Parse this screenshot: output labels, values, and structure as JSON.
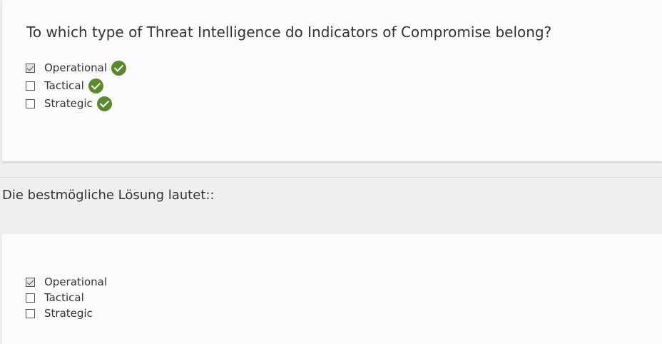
{
  "question": {
    "text": "To which type of Threat Intelligence do Indicators of Compromise belong?",
    "options": [
      {
        "label": "Operational",
        "checked": true,
        "feedback": "correct-check-icon"
      },
      {
        "label": "Tactical",
        "checked": false,
        "feedback": "correct-check-icon"
      },
      {
        "label": "Strategic",
        "checked": false,
        "feedback": "correct-check-icon"
      }
    ]
  },
  "solution": {
    "heading": "Die bestmögliche Lösung lautet::",
    "options": [
      {
        "label": "Operational",
        "checked": true
      },
      {
        "label": "Tactical",
        "checked": false
      },
      {
        "label": "Strategic",
        "checked": false
      }
    ]
  },
  "colors": {
    "correct": "#5a8a2c",
    "card_bg": "#fbfbfb",
    "page_bg": "#efefef"
  }
}
